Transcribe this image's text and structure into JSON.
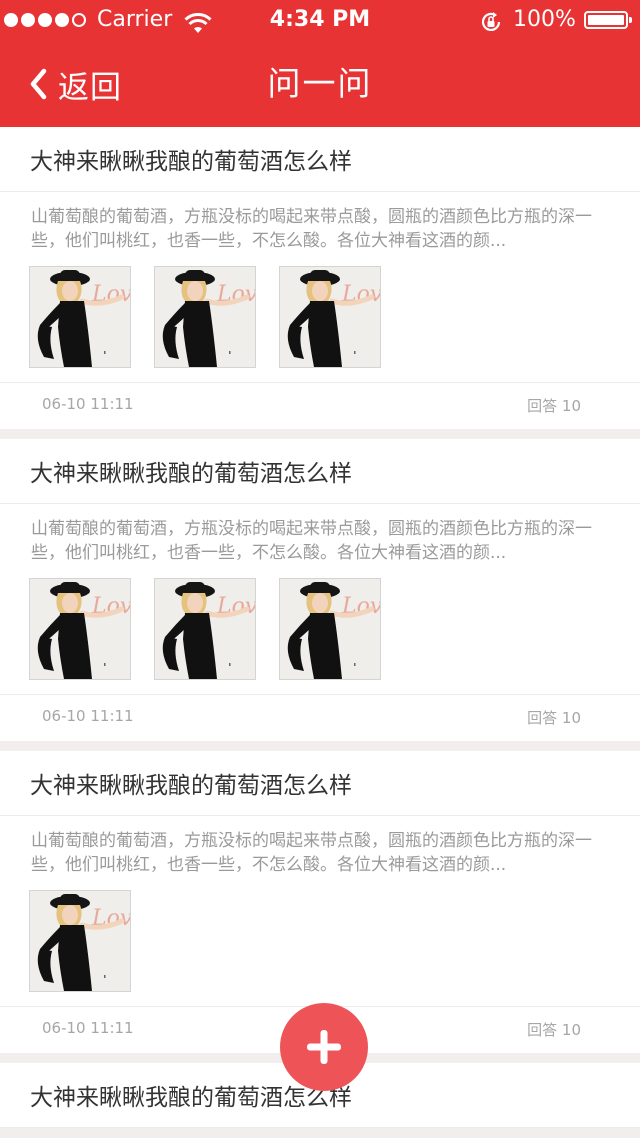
{
  "status_bar": {
    "carrier": "Carrier",
    "time": "4:34 PM",
    "battery": "100%",
    "signal_icon": "signal-dots-icon",
    "wifi_icon": "wifi-icon",
    "rotation_lock_icon": "rotation-lock-icon",
    "battery_icon": "battery-icon"
  },
  "nav": {
    "back_label": "返回",
    "back_icon": "chevron-left-icon",
    "title": "问一问"
  },
  "colors": {
    "header": "#e83334",
    "fab": "#ee5457",
    "background": "#f3eeee"
  },
  "questions": [
    {
      "title": "大神来瞅瞅我酿的葡萄酒怎么样",
      "summary": "山葡萄酿的葡萄酒，方瓶没标的喝起来带点酸，圆瓶的酒颜色比方瓶的深一些，他们叫桃红，也香一些，不怎么酸。各位大神看这酒的颜...",
      "image_count": 3,
      "date": "06-10 11:11",
      "answers": "回答 10"
    },
    {
      "title": "大神来瞅瞅我酿的葡萄酒怎么样",
      "summary": "山葡萄酿的葡萄酒，方瓶没标的喝起来带点酸，圆瓶的酒颜色比方瓶的深一些，他们叫桃红，也香一些，不怎么酸。各位大神看这酒的颜...",
      "image_count": 3,
      "date": "06-10 11:11",
      "answers": "回答 10"
    },
    {
      "title": "大神来瞅瞅我酿的葡萄酒怎么样",
      "summary": "山葡萄酿的葡萄酒，方瓶没标的喝起来带点酸，圆瓶的酒颜色比方瓶的深一些，他们叫桃红，也香一些，不怎么酸。各位大神看这酒的颜...",
      "image_count": 1,
      "date": "06-10 11:11",
      "answers": "回答 10"
    },
    {
      "title": "大神来瞅瞅我酿的葡萄酒怎么样"
    }
  ],
  "fab": {
    "icon": "plus-icon"
  }
}
